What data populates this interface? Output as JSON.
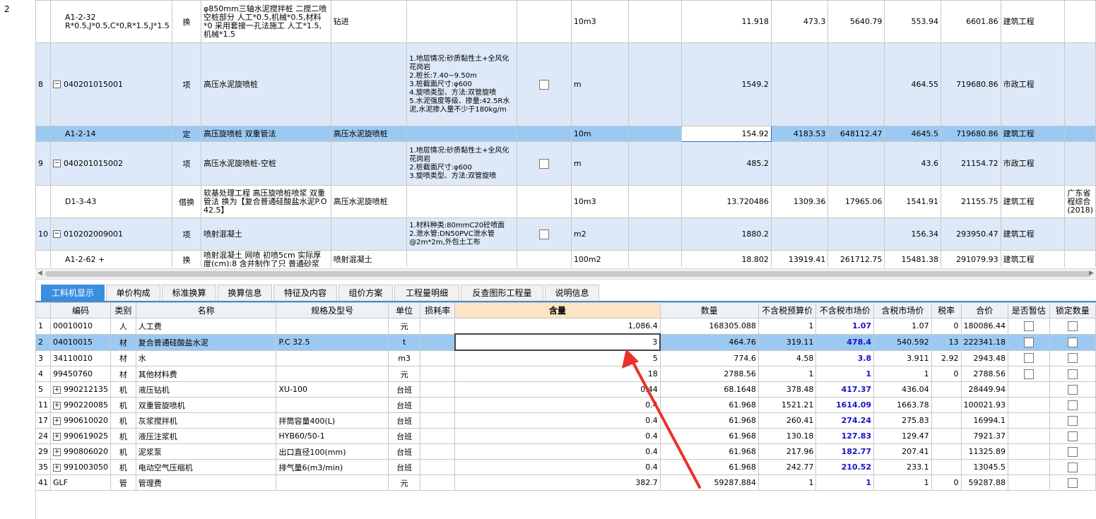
{
  "gutter": {
    "row_no": "2"
  },
  "upper_rows": [
    {
      "style": "white",
      "no": "",
      "code": "A1-2-32 R*0.5,J*0.5,C*0,R*1.5,J*1.5",
      "type": "换",
      "name": "φ850mm三轴水泥搅拌桩 二搅二喷 空桩部分 人工*0.5,机械*0.5,材料*0 采用套接一孔法施工 人工*1.5,机械*1.5",
      "spec": "钻进",
      "feature": "",
      "unit": "10m3",
      "qty": "11.918",
      "p1": "473.3",
      "p2": "5640.79",
      "p3": "553.94",
      "p4": "6601.86",
      "cat": "建筑工程",
      "extra": ""
    },
    {
      "style": "blue",
      "no": "8",
      "code": "040201015001",
      "type": "项",
      "name": "高压水泥旋喷桩",
      "spec": "",
      "feature": "1.地层情况:砂质黏性土+全风化花岗岩\n2.桩长:7.40~9.50m\n3.桩截面尺寸:φ600\n4.旋喷类型、方法:双管旋喷\n5.水泥强度等级、掺量:42.5R水泥,水泥掺入量不少于180kg/m",
      "unit": "m",
      "qty": "1549.2",
      "p1": "",
      "p2": "",
      "p3": "464.55",
      "p4": "719680.86",
      "cat": "市政工程",
      "extra": ""
    },
    {
      "style": "sel",
      "no": "",
      "code": "A1-2-14",
      "type": "定",
      "name": "高压旋喷桩 双重管法",
      "spec": "高压水泥旋喷桩",
      "feature": "",
      "unit": "10m",
      "qty": "154.92",
      "p1": "4183.53",
      "p2": "648112.47",
      "p3": "4645.5",
      "p4": "719680.86",
      "cat": "建筑工程",
      "extra": ""
    },
    {
      "style": "blue",
      "no": "9",
      "code": "040201015002",
      "type": "项",
      "name": "高压水泥旋喷桩-空桩",
      "spec": "",
      "feature": "1.地层情况:砂质黏性土+全风化花岗岩\n2.桩截面尺寸:φ600\n3.旋喷类型、方法:双管旋喷",
      "unit": "m",
      "qty": "485.2",
      "p1": "",
      "p2": "",
      "p3": "43.6",
      "p4": "21154.72",
      "cat": "市政工程",
      "extra": ""
    },
    {
      "style": "white",
      "no": "",
      "code": "D1-3-43",
      "type": "借换",
      "name": "软基处理工程 高压旋喷桩喷浆 双重管法 换为【复合普通硅酸盐水泥P.O 42.5】",
      "spec": "高压水泥旋喷桩",
      "feature": "",
      "unit": "10m3",
      "qty": "13.720486",
      "p1": "1309.36",
      "p2": "17965.06",
      "p3": "1541.91",
      "p4": "21155.75",
      "cat": "建筑工程",
      "extra": "广东省程综合(2018)"
    },
    {
      "style": "blue",
      "no": "10",
      "code": "010202009001",
      "type": "项",
      "name": "喷射混凝土",
      "spec": "",
      "feature": "1.材料种类:80mmC20砼喷面\n2.泄水管:DN50PVC泄水管@2m*2m,外包土工布",
      "unit": "m2",
      "qty": "1880.2",
      "p1": "",
      "p2": "",
      "p3": "156.34",
      "p4": "293950.47",
      "cat": "建筑工程",
      "extra": ""
    },
    {
      "style": "white",
      "no": "",
      "code": "A1-2-62 +",
      "type": "换",
      "name": "喷射混凝土 网喷 初喷5cm 实际厚度(cm):8 含并制作了只 普通砂浆",
      "spec": "喷射混凝土",
      "feature": "",
      "unit": "100m2",
      "qty": "18.802",
      "p1": "13919.41",
      "p2": "261712.75",
      "p3": "15481.38",
      "p4": "291079.93",
      "cat": "建筑工程",
      "extra": ""
    }
  ],
  "tabs": [
    "工料机显示",
    "单价构成",
    "标准换算",
    "换算信息",
    "特征及内容",
    "组价方案",
    "工程量明细",
    "反查图形工程量",
    "说明信息"
  ],
  "lower_headers": [
    "编码",
    "类别",
    "名称",
    "规格及型号",
    "单位",
    "损耗率",
    "含量",
    "数量",
    "不含税预算价",
    "不含税市场价",
    "含税市场价",
    "税率",
    "合价",
    "是否暂估",
    "锁定数量"
  ],
  "lower_rows": [
    {
      "no": "1",
      "expand": false,
      "code": "00010010",
      "type": "人",
      "name": "人工费",
      "spec": "",
      "unit": "元",
      "loss": "",
      "content": "1,086.4",
      "qty": "168305.088",
      "bp": "1",
      "mp": "1.07",
      "tp": "1.07",
      "tax": "0",
      "total": "180086.44",
      "est": true,
      "lock": true
    },
    {
      "no": "2",
      "expand": false,
      "code": "04010015",
      "type": "材",
      "name": "复合普通硅酸盐水泥",
      "spec": "P.C 32.5",
      "unit": "t",
      "loss": "",
      "content": "3",
      "qty": "464.76",
      "bp": "319.11",
      "mp": "478.4",
      "tp": "540.592",
      "tax": "13",
      "total": "222341.18",
      "est": true,
      "lock": true
    },
    {
      "no": "3",
      "expand": false,
      "code": "34110010",
      "type": "材",
      "name": "水",
      "spec": "",
      "unit": "m3",
      "loss": "",
      "content": "5",
      "qty": "774.6",
      "bp": "4.58",
      "mp": "3.8",
      "tp": "3.911",
      "tax": "2.92",
      "total": "2943.48",
      "est": true,
      "lock": true
    },
    {
      "no": "4",
      "expand": false,
      "code": "99450760",
      "type": "材",
      "name": "其他材料费",
      "spec": "",
      "unit": "元",
      "loss": "",
      "content": "18",
      "qty": "2788.56",
      "bp": "1",
      "mp": "1",
      "tp": "1",
      "tax": "0",
      "total": "2788.56",
      "est": true,
      "lock": true
    },
    {
      "no": "5",
      "expand": true,
      "code": "990212135",
      "type": "机",
      "name": "液压钻机",
      "spec": "XU-100",
      "unit": "台班",
      "loss": "",
      "content": "0.44",
      "qty": "68.1648",
      "bp": "378.48",
      "mp": "417.37",
      "tp": "436.04",
      "tax": "",
      "total": "28449.94",
      "est": false,
      "lock": true
    },
    {
      "no": "11",
      "expand": true,
      "code": "990220085",
      "type": "机",
      "name": "双重管旋喷机",
      "spec": "",
      "unit": "台班",
      "loss": "",
      "content": "0.4",
      "qty": "61.968",
      "bp": "1521.21",
      "mp": "1614.09",
      "tp": "1663.78",
      "tax": "",
      "total": "100021.93",
      "est": false,
      "lock": true
    },
    {
      "no": "17",
      "expand": true,
      "code": "990610020",
      "type": "机",
      "name": "灰浆搅拌机",
      "spec": "拌筒容量400(L)",
      "unit": "台班",
      "loss": "",
      "content": "0.4",
      "qty": "61.968",
      "bp": "260.41",
      "mp": "274.24",
      "tp": "275.83",
      "tax": "",
      "total": "16994.1",
      "est": false,
      "lock": true
    },
    {
      "no": "24",
      "expand": true,
      "code": "990619025",
      "type": "机",
      "name": "液压注浆机",
      "spec": "HYB60/50-1",
      "unit": "台班",
      "loss": "",
      "content": "0.4",
      "qty": "61.968",
      "bp": "130.18",
      "mp": "127.83",
      "tp": "129.47",
      "tax": "",
      "total": "7921.37",
      "est": false,
      "lock": true
    },
    {
      "no": "29",
      "expand": true,
      "code": "990806020",
      "type": "机",
      "name": "泥浆泵",
      "spec": "出口直径100(mm)",
      "unit": "台班",
      "loss": "",
      "content": "0.4",
      "qty": "61.968",
      "bp": "217.96",
      "mp": "182.77",
      "tp": "207.41",
      "tax": "",
      "total": "11325.89",
      "est": false,
      "lock": true
    },
    {
      "no": "35",
      "expand": true,
      "code": "991003050",
      "type": "机",
      "name": "电动空气压缩机",
      "spec": "排气量6(m3/min)",
      "unit": "台班",
      "loss": "",
      "content": "0.4",
      "qty": "61.968",
      "bp": "242.77",
      "mp": "210.52",
      "tp": "233.1",
      "tax": "",
      "total": "13045.5",
      "est": false,
      "lock": true
    },
    {
      "no": "41",
      "expand": false,
      "code": "GLF",
      "type": "管",
      "name": "管理费",
      "spec": "",
      "unit": "元",
      "loss": "",
      "content": "382.7",
      "qty": "59287.884",
      "bp": "1",
      "mp": "1",
      "tp": "1",
      "tax": "0",
      "total": "59287.88",
      "est": false,
      "lock": true
    }
  ],
  "colors": {
    "tab_active": "#3a8ee0",
    "selected_row": "#9cc9f2",
    "item_row": "#dde9f8",
    "arrow": "#e8332a",
    "market_price": "#1515c8"
  }
}
